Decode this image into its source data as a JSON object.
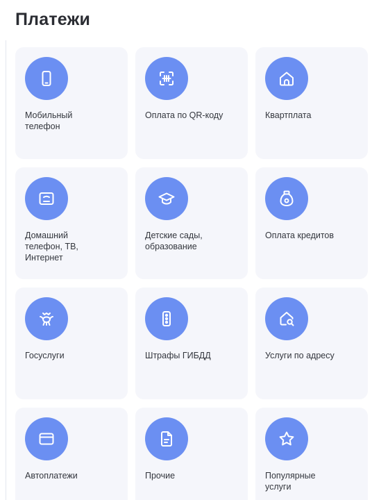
{
  "header": {
    "title": "Платежи"
  },
  "colors": {
    "accent": "#6b8ff2",
    "tile_background": "#f5f6fb",
    "text": "#33363d"
  },
  "tiles": [
    {
      "label": "Мобильный\nтелефон",
      "icon": "mobile-phone-icon"
    },
    {
      "label": "Оплата по QR-коду",
      "icon": "qr-scan-icon"
    },
    {
      "label": "Квартплата",
      "icon": "house-icon"
    },
    {
      "label": "Домашний\nтелефон, ТВ,\nИнтернет",
      "icon": "tv-monitor-icon"
    },
    {
      "label": "Детские сады,\nобразование",
      "icon": "graduation-cap-icon"
    },
    {
      "label": "Оплата кредитов",
      "icon": "money-bag-icon"
    },
    {
      "label": "Госуслуги",
      "icon": "state-emblem-icon"
    },
    {
      "label": "Штрафы ГИБДД",
      "icon": "traffic-light-icon"
    },
    {
      "label": "Услуги по адресу",
      "icon": "house-search-icon"
    },
    {
      "label": "Автоплатежи",
      "icon": "card-icon"
    },
    {
      "label": "Прочие",
      "icon": "document-icon"
    },
    {
      "label": "Популярные\nуслуги",
      "icon": "star-icon"
    }
  ]
}
